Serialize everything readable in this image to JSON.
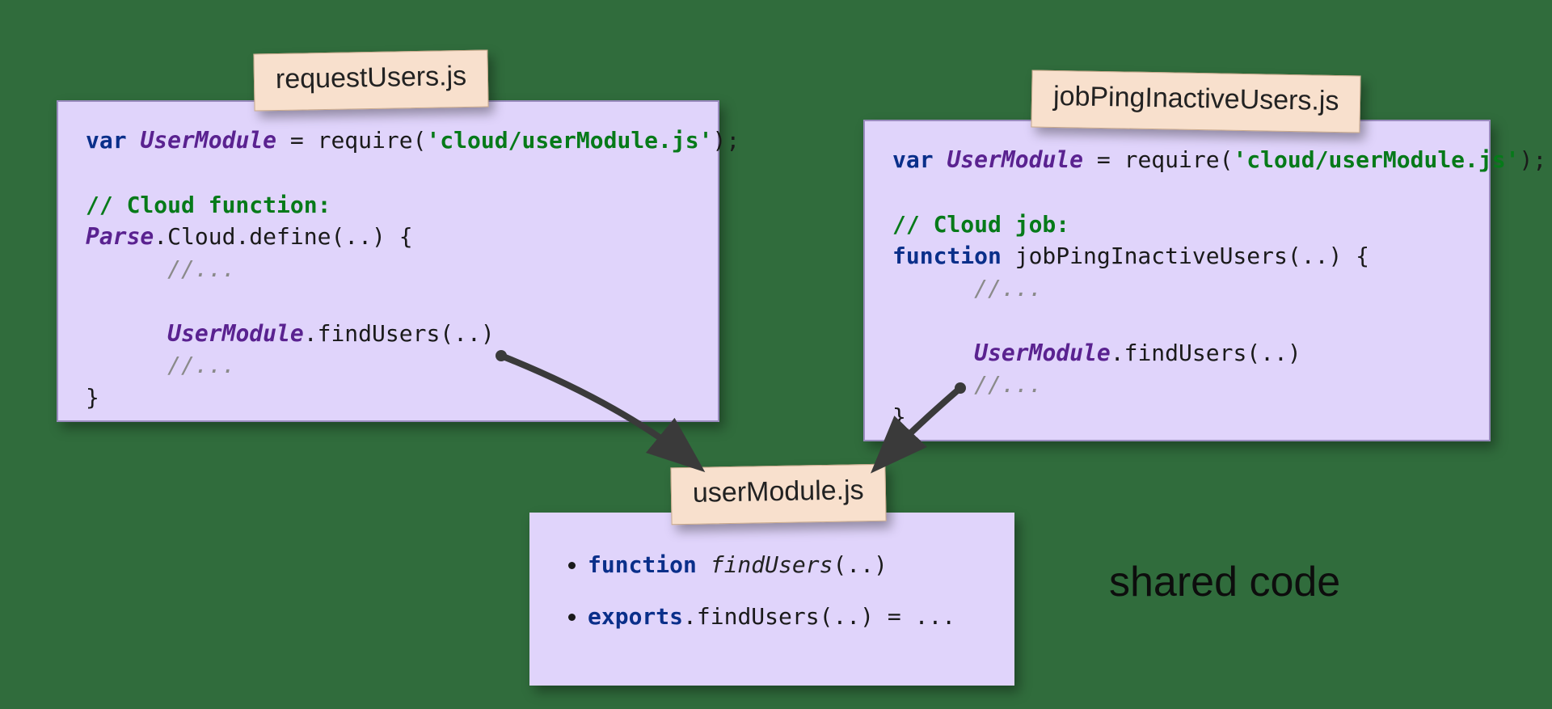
{
  "boxes": {
    "left": {
      "tag": "requestUsers.js",
      "code": {
        "l1_var": "var",
        "l1_module": "UserModule",
        "l1_assign": " = require(",
        "l1_str": "'cloud/userModule.js'",
        "l1_end": ");",
        "l3_comment": "// Cloud function:",
        "l4_parse": "Parse",
        "l4_rest": ".Cloud.define(..) {",
        "l5_c": "//...",
        "l7_mod": "UserModule",
        "l7_call": ".findUsers(..)",
        "l8_c": "//...",
        "l9": "}"
      }
    },
    "right": {
      "tag": "jobPingInactiveUsers.js",
      "code": {
        "l1_var": "var",
        "l1_module": "UserModule",
        "l1_assign": " = require(",
        "l1_str": "'cloud/userModule.js'",
        "l1_end": ");",
        "l3_comment": "// Cloud job:",
        "l4_fn": "function",
        "l4_name": " jobPingInactiveUsers(..) {",
        "l5_c": "//...",
        "l7_mod": "UserModule",
        "l7_call": ".findUsers(..)",
        "l8_c": "//...",
        "l9": "}"
      }
    },
    "bottom": {
      "tag": "userModule.js",
      "items": {
        "i1_fn": "function",
        "i1_name": "findUsers",
        "i1_rest": "(..)",
        "i2_exp": "exports",
        "i2_rest": ".findUsers(..) = ..."
      }
    }
  },
  "shared_label": "shared code"
}
